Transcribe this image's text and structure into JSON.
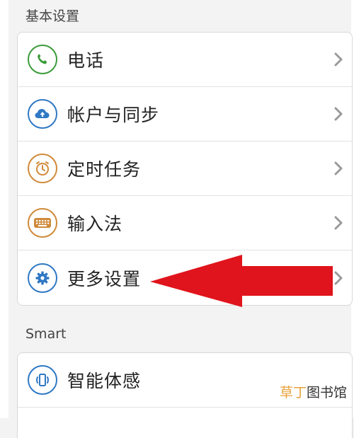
{
  "sections": {
    "basic_title": "基本设置",
    "smart_title": "Smart"
  },
  "basic_items": [
    {
      "label": "电话",
      "icon": "phone-icon",
      "color": "#3a9b3a"
    },
    {
      "label": "帐户与同步",
      "icon": "cloud-sync-icon",
      "color": "#2f78c4"
    },
    {
      "label": "定时任务",
      "icon": "clock-icon",
      "color": "#d08a3a"
    },
    {
      "label": "输入法",
      "icon": "keyboard-icon",
      "color": "#d08a3a"
    },
    {
      "label": "更多设置",
      "icon": "gear-icon",
      "color": "#2f78c4"
    }
  ],
  "smart_items": [
    {
      "label": "智能体感",
      "icon": "phone-gesture-icon",
      "color": "#2f78c4"
    }
  ],
  "annotation": {
    "arrow_color": "#e0141c"
  },
  "watermark": {
    "part1": "草丁",
    "part2": "图书馆"
  }
}
